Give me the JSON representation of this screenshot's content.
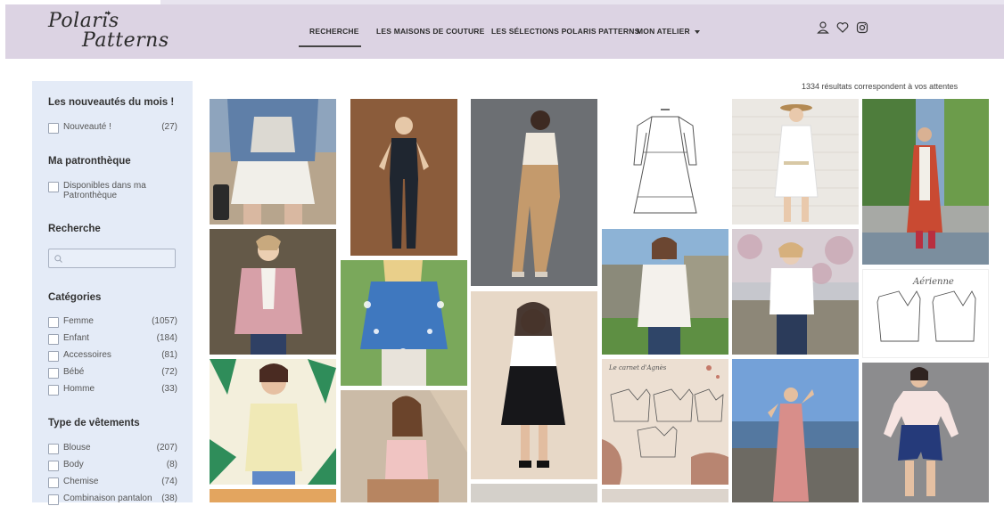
{
  "brand": {
    "line1": "Polaris",
    "line2": "Patterns"
  },
  "nav": {
    "items": [
      "RECHERCHE",
      "LES MAISONS DE COUTURE",
      "LES SÉLECTIONS POLARIS PATTERNS",
      "MON ATELIER"
    ],
    "active": "RECHERCHE"
  },
  "header_icons": [
    "user-icon",
    "heart-icon",
    "instagram-icon"
  ],
  "results_text": "1334 résultats correspondent à vos attentes",
  "sidebar": {
    "new_title": "Les nouveautés du mois !",
    "new_item": {
      "label": "Nouveauté !",
      "count": "(27)"
    },
    "library_title": "Ma patronthèque",
    "library_item": {
      "line1": "Disponibles dans ma",
      "line2": "Patronthèque"
    },
    "search_title": "Recherche",
    "search_placeholder": "",
    "categories_title": "Catégories",
    "categories": [
      {
        "label": "Femme",
        "count": "(1057)"
      },
      {
        "label": "Enfant",
        "count": "(184)"
      },
      {
        "label": "Accessoires",
        "count": "(81)"
      },
      {
        "label": "Bébé",
        "count": "(72)"
      },
      {
        "label": "Homme",
        "count": "(33)"
      }
    ],
    "types_title": "Type de vêtements",
    "types": [
      {
        "label": "Blouse",
        "count": "(207)"
      },
      {
        "label": "Body",
        "count": "(8)"
      },
      {
        "label": "Chemise",
        "count": "(74)"
      },
      {
        "label": "Combinaison pantalon",
        "count": "(38)"
      }
    ]
  },
  "gallery_text": {
    "pattern_name": "Aérienne",
    "sketch_title": "Le carnet d'Agnès"
  },
  "colors": {
    "header": "#dcd3e3",
    "sidebar": "#e4ebf7",
    "text": "#333333"
  }
}
